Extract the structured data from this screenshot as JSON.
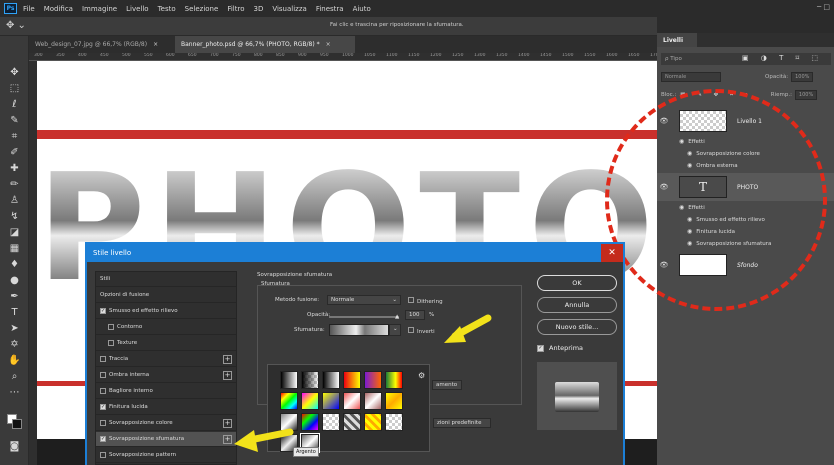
{
  "app": {
    "logo": "Ps",
    "win_controls": "─ □"
  },
  "menu": [
    "File",
    "Modifica",
    "Immagine",
    "Livello",
    "Testo",
    "Selezione",
    "Filtro",
    "3D",
    "Visualizza",
    "Finestra",
    "Aiuto"
  ],
  "options_bar": {
    "tool": "✥ ⌄",
    "hint": "Fai clic e trascina per riposizionare la sfumatura."
  },
  "tabs": [
    {
      "label": "Web_design_07.jpg @ 66,7% (RGB/8)",
      "close": "×"
    },
    {
      "label": "Banner_photo.psd @ 66,7% (PHOTO, RGB/8) *",
      "close": "×"
    }
  ],
  "ruler": [
    "300",
    "350",
    "400",
    "450",
    "500",
    "550",
    "600",
    "650",
    "700",
    "750",
    "800",
    "850",
    "900",
    "950",
    "1000",
    "1050",
    "1100",
    "1150",
    "1200",
    "1250",
    "1300",
    "1350",
    "1400",
    "1450",
    "1500",
    "1550",
    "1600",
    "1650",
    "1700"
  ],
  "canvas": {
    "text": "PHOTO"
  },
  "layers": {
    "tab": "Livelli",
    "filter": "ρ Tipo",
    "filter_icons": "▣ ◑ T ⌑ ⬚",
    "blend_label": "Normale",
    "opacity_label": "Opacità:",
    "opacity_value": "100%",
    "lock_label": "Bloc.:",
    "fill_label": "Riemp.:",
    "fill_value": "100%",
    "items": [
      {
        "name": "Livello 1",
        "fx_label": "Effetti",
        "effects": [
          "Sovrapposizione colore",
          "Ombra esterna"
        ]
      },
      {
        "name": "PHOTO",
        "thumb_text": "T",
        "fx_label": "Effetti",
        "effects": [
          "Smusso ed effetto rilievo",
          "Finitura lucida",
          "Sovrapposizione sfumatura"
        ]
      },
      {
        "name": "Sfondo"
      }
    ]
  },
  "dialog": {
    "title": "Stile livello",
    "close": "✕",
    "styles": [
      {
        "label": "Stili",
        "checkbox": false,
        "show_check": false,
        "plus": false
      },
      {
        "label": "Opzioni di fusione",
        "checkbox": false,
        "show_check": false,
        "plus": false
      },
      {
        "label": "Smusso ed effetto rilievo",
        "checkbox": true,
        "show_check": true,
        "plus": false
      },
      {
        "label": "Contorno",
        "checkbox": false,
        "show_check": true,
        "plus": false,
        "indent": true
      },
      {
        "label": "Texture",
        "checkbox": false,
        "show_check": true,
        "plus": false,
        "indent": true
      },
      {
        "label": "Traccia",
        "checkbox": false,
        "show_check": true,
        "plus": true
      },
      {
        "label": "Ombra interna",
        "checkbox": false,
        "show_check": true,
        "plus": true
      },
      {
        "label": "Bagliore interno",
        "checkbox": false,
        "show_check": true,
        "plus": false
      },
      {
        "label": "Finitura lucida",
        "checkbox": true,
        "show_check": true,
        "plus": false
      },
      {
        "label": "Sovrapposizione colore",
        "checkbox": false,
        "show_check": true,
        "plus": true
      },
      {
        "label": "Sovrapposizione sfumatura",
        "checkbox": true,
        "show_check": true,
        "plus": true,
        "selected": true
      },
      {
        "label": "Sovrapposizione pattern",
        "checkbox": false,
        "show_check": true,
        "plus": false
      }
    ],
    "section_title": "Sovrapposizione sfumatura",
    "section_sub": "Sfumatura",
    "blend_mode_label": "Metodo fusione:",
    "blend_mode_value": "Normale",
    "dithering": "Dithering",
    "opacity_label": "Opacità:",
    "opacity_value": "100",
    "opacity_unit": "%",
    "gradient_label": "Sfumatura:",
    "invert": "Inverti",
    "align_fragment": "amento",
    "defaults_fragment": "zioni predefinite",
    "tooltip": "Argento",
    "gear": "⚙",
    "buttons": {
      "ok": "OK",
      "reset": "Annulla",
      "new_style": "Nuovo stile...",
      "preview": "Anteprima"
    }
  },
  "colors": {
    "accent": "#1c7fd6",
    "circle": "#e02a1a",
    "arrow": "#f2e21a",
    "stripe": "#c9302c"
  }
}
